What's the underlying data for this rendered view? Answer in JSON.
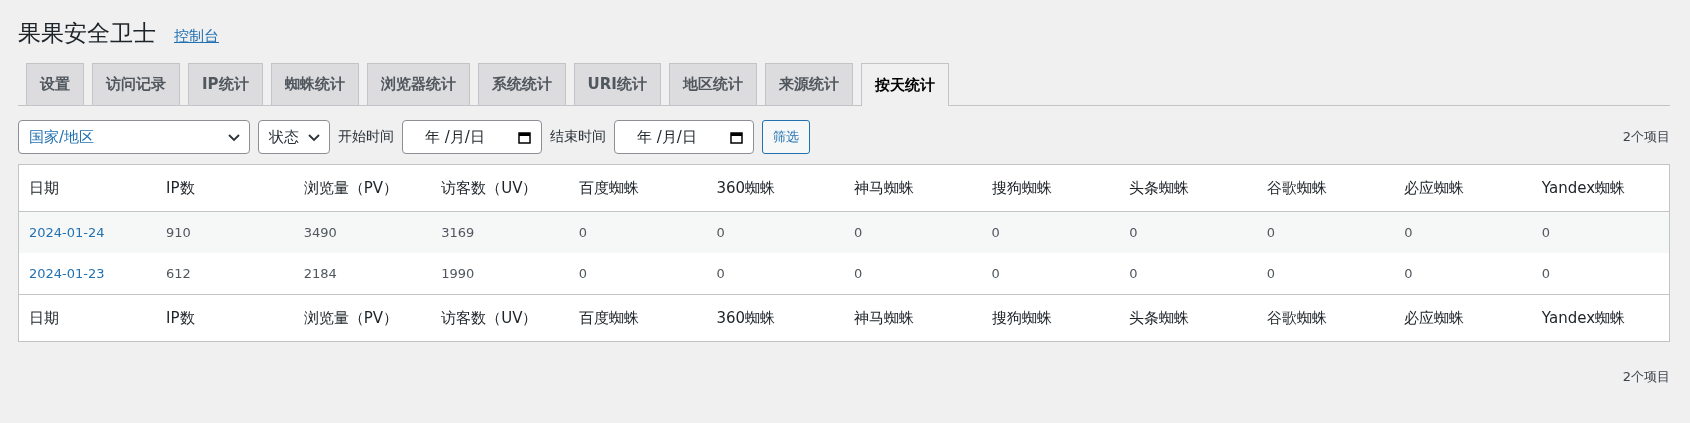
{
  "page": {
    "title": "果果安全卫士",
    "link": "控制台"
  },
  "tabs": [
    {
      "label": "设置",
      "selected": false
    },
    {
      "label": "访问记录",
      "selected": false
    },
    {
      "label": "IP统计",
      "selected": false
    },
    {
      "label": "蜘蛛统计",
      "selected": false
    },
    {
      "label": "浏览器统计",
      "selected": false
    },
    {
      "label": "系统统计",
      "selected": false
    },
    {
      "label": "URI统计",
      "selected": false
    },
    {
      "label": "地区统计",
      "selected": false
    },
    {
      "label": "来源统计",
      "selected": false
    },
    {
      "label": "按天统计",
      "selected": true
    }
  ],
  "filters": {
    "country": "国家/地区",
    "status": "状态",
    "start_label": "开始时间",
    "start_date": "年 /月/日",
    "end_label": "结束时间",
    "end_date": "年 /月/日",
    "button": "筛选"
  },
  "count_top": "2个项目",
  "table": {
    "columns": [
      "日期",
      "IP数",
      "浏览量（PV）",
      "访客数（UV）",
      "百度蜘蛛",
      "360蜘蛛",
      "神马蜘蛛",
      "搜狗蜘蛛",
      "头条蜘蛛",
      "谷歌蜘蛛",
      "必应蜘蛛",
      "Yandex蜘蛛"
    ],
    "rows": [
      [
        "2024-01-24",
        "910",
        "3490",
        "3169",
        "0",
        "0",
        "0",
        "0",
        "0",
        "0",
        "0",
        "0"
      ],
      [
        "2024-01-23",
        "612",
        "2184",
        "1990",
        "0",
        "0",
        "0",
        "0",
        "0",
        "0",
        "0",
        "0"
      ]
    ],
    "footer": [
      "日期",
      "IP数",
      "浏览量（PV）",
      "访客数（UV）",
      "百度蜘蛛",
      "360蜘蛛",
      "神马蜘蛛",
      "搜狗蜘蛛",
      "头条蜘蛛",
      "谷歌蜘蛛",
      "必应蜘蛛",
      "Yandex蜘蛛"
    ]
  },
  "count_bottom": "2个项目"
}
